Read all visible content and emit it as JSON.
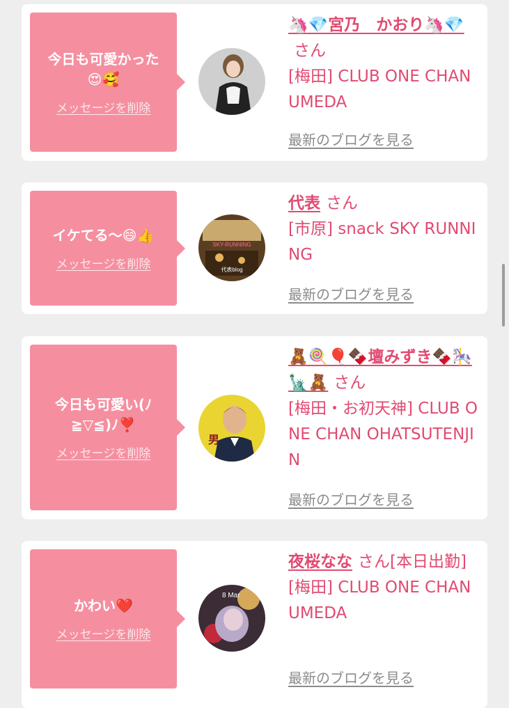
{
  "delete_label": "メッセージを削除",
  "blog_label": "最新のブログを見る",
  "colors": {
    "background": "#efeeef",
    "bubble": "#f58fa0",
    "accent": "#e14a71",
    "link_gray": "#8b8b8b"
  },
  "messages": [
    {
      "text": "今日も可愛かった\n😍🥰",
      "name": "🦄💎宮乃　かおり🦄💎",
      "honorific": "さん",
      "shop": "[梅田] CLUB ONE CHAN UMEDA"
    },
    {
      "text": "イケてる〜😄👍",
      "name": "代表",
      "honorific": "さん",
      "shop": "[市原] snack SKY RUNNING",
      "avatar_text_top": "SKY-RUNNING",
      "avatar_text_bottom": "代表blog"
    },
    {
      "text": "今日も可愛い(ﾉ\n≧▽≦)ﾉ❣️",
      "name": "🧸🍭🎈🍫壇みずき🍫🎠🗽🧸",
      "honorific": "さん",
      "shop": "[梅田・お初天神] CLUB ONE CHAN OHATSUTENJIN",
      "avatar_text": "男"
    },
    {
      "text": "かわい❤️",
      "name": "夜桜なな",
      "honorific": "さん[本日出勤]",
      "shop": "[梅田] CLUB ONE CHAN UMEDA",
      "avatar_text": "8 Mar"
    }
  ]
}
